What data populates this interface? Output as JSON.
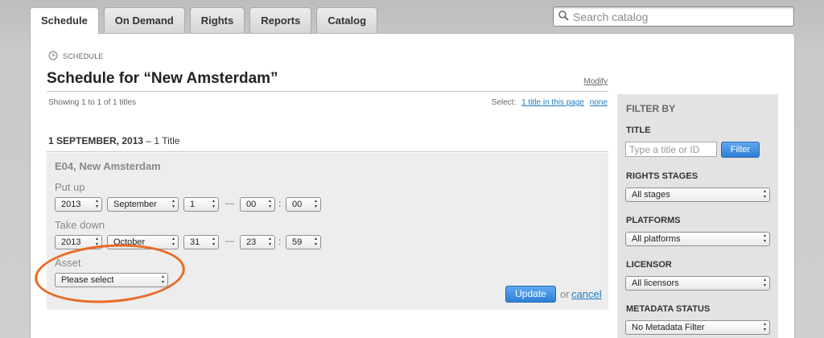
{
  "tabs": [
    {
      "label": "Schedule",
      "active": true
    },
    {
      "label": "On Demand"
    },
    {
      "label": "Rights"
    },
    {
      "label": "Reports"
    },
    {
      "label": "Catalog"
    }
  ],
  "search": {
    "placeholder": "Search catalog",
    "icon": "search-icon"
  },
  "breadcrumb": {
    "icon": "clock-icon",
    "label": "SCHEDULE"
  },
  "page": {
    "title": "Schedule for “New Amsterdam”",
    "modify": "Modify",
    "showing": "Showing 1 to 1 of 1 titles",
    "select_label": "Select:",
    "select_page": "1 title in this page",
    "select_none": "none"
  },
  "date_group": {
    "date": "1 SEPTEMBER, 2013",
    "count": " – 1 Title"
  },
  "edit": {
    "episode": "E04, New Amsterdam",
    "put_up": {
      "label": "Put up",
      "year": "2013",
      "month": "September",
      "day": "1",
      "hour": "00",
      "minute": "00"
    },
    "take_down": {
      "label": "Take down",
      "year": "2013",
      "month": "October",
      "day": "31",
      "hour": "23",
      "minute": "59"
    },
    "separator_dash": "—",
    "separator_colon": ":",
    "asset": {
      "label": "Asset",
      "value": "Please select"
    },
    "update": "Update",
    "or": "or",
    "cancel": "cancel"
  },
  "highlight_color": "#e86a25",
  "sidebar": {
    "heading": "FILTER BY",
    "title_label": "TITLE",
    "title_placeholder": "Type a title or ID",
    "filter_button": "Filter",
    "rights_label": "RIGHTS STAGES",
    "rights_value": "All stages",
    "platforms_label": "PLATFORMS",
    "platforms_value": "All platforms",
    "licensor_label": "LICENSOR",
    "licensor_value": "All licensors",
    "metadata_label": "METADATA STATUS",
    "metadata_value": "No Metadata Filter"
  }
}
